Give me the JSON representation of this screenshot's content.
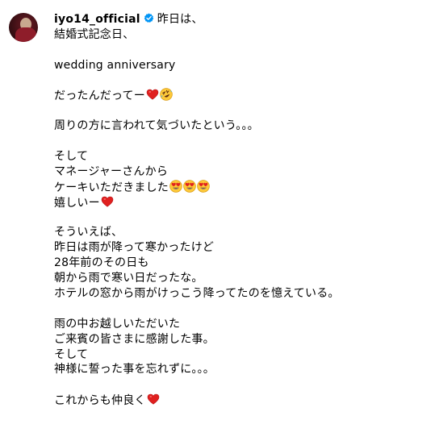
{
  "post": {
    "username": "iyo14_official",
    "verified_icon": "verified-badge-icon",
    "lines": [
      "昨日は、",
      "結婚式記念日、",
      "",
      "wedding anniversary",
      "",
      "だったんだってー",
      "",
      "周りの方に言われて気づいたという。。。",
      "",
      "そして",
      "マネージャーさんから",
      "ケーキいただきました",
      "嬉しいー",
      "",
      "そういえば、",
      "昨日は雨が降って寒かったけど",
      "28年前のその日も",
      "朝から雨で寒い日だったな。",
      "ホテルの窓から雨がけっこう降ってたのを憶えている。",
      "",
      "雨の中お越しいただいた",
      "ご来賓の皆さまに感謝した事。",
      "そして",
      "神様に誓った事を忘れずに。。。",
      "",
      "これからも仲良く"
    ],
    "emojis": {
      "line5": [
        "red-heart-icon",
        "rolling-laughing-face-icon"
      ],
      "line11": [
        "heart-eyes-face-icon",
        "heart-eyes-face-icon",
        "heart-eyes-face-icon"
      ],
      "line12": [
        "red-heart-icon"
      ],
      "line25": [
        "red-heart-icon"
      ]
    }
  },
  "colors": {
    "verified_blue": "#0095f6",
    "heart_red": "#e0201f",
    "emoji_yellow": "#fdc939"
  }
}
